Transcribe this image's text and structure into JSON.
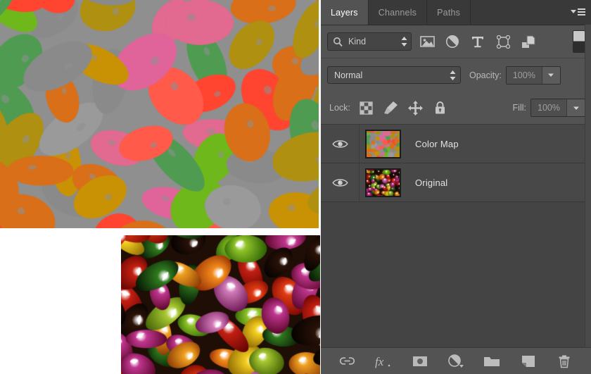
{
  "panel": {
    "tabs": [
      {
        "label": "Layers",
        "active": true
      },
      {
        "label": "Channels",
        "active": false
      },
      {
        "label": "Paths",
        "active": false
      }
    ],
    "menu_icon": "panel-menu-icon",
    "filter": {
      "search_icon": "search-icon",
      "kind_label": "Kind",
      "stepper_icon": "updown-stepper-icon",
      "icons": [
        "pixel-layer-filter-icon",
        "adjustment-layer-filter-icon",
        "type-layer-filter-icon",
        "shape-layer-filter-icon",
        "smart-object-filter-icon"
      ],
      "toggle_icon": "filter-enable-toggle"
    },
    "blend": {
      "mode": "Normal",
      "stepper_icon": "updown-stepper-icon",
      "opacity_label": "Opacity:",
      "opacity_value": "100%",
      "opacity_arrow_icon": "chevron-down-icon"
    },
    "lock": {
      "label": "Lock:",
      "icons": [
        "lock-transparent-pixels-icon",
        "lock-image-pixels-icon",
        "lock-position-icon",
        "lock-all-icon"
      ],
      "fill_label": "Fill:",
      "fill_value": "100%",
      "fill_arrow_icon": "chevron-down-icon"
    },
    "layers": [
      {
        "name": "Color Map",
        "visible": true,
        "visibility_icon": "eye-icon",
        "thumbnail": "colormap-thumbnail"
      },
      {
        "name": "Original",
        "visible": true,
        "visibility_icon": "eye-icon",
        "thumbnail": "original-thumbnail"
      }
    ],
    "bottom_tools": [
      "link-layers-icon",
      "layer-style-fx-icon",
      "add-layer-mask-icon",
      "new-adjustment-layer-icon",
      "new-group-icon",
      "new-layer-icon",
      "delete-layer-icon"
    ]
  },
  "canvas": {
    "colormap_image": "posterized-jellybeans-color-map",
    "original_image": "jellybeans-photograph",
    "background": "#ffffff"
  },
  "colors": {
    "panel_bg": "#535353",
    "tab_bar_bg": "#353535",
    "tab_active_bg": "#535353",
    "layer_list_bg": "#444444",
    "layer_row_bg": "#484848",
    "text": "#d4d4d4",
    "text_bright": "#ffffff",
    "text_dim": "#9f9f9f",
    "border": "#2e2e2e"
  }
}
